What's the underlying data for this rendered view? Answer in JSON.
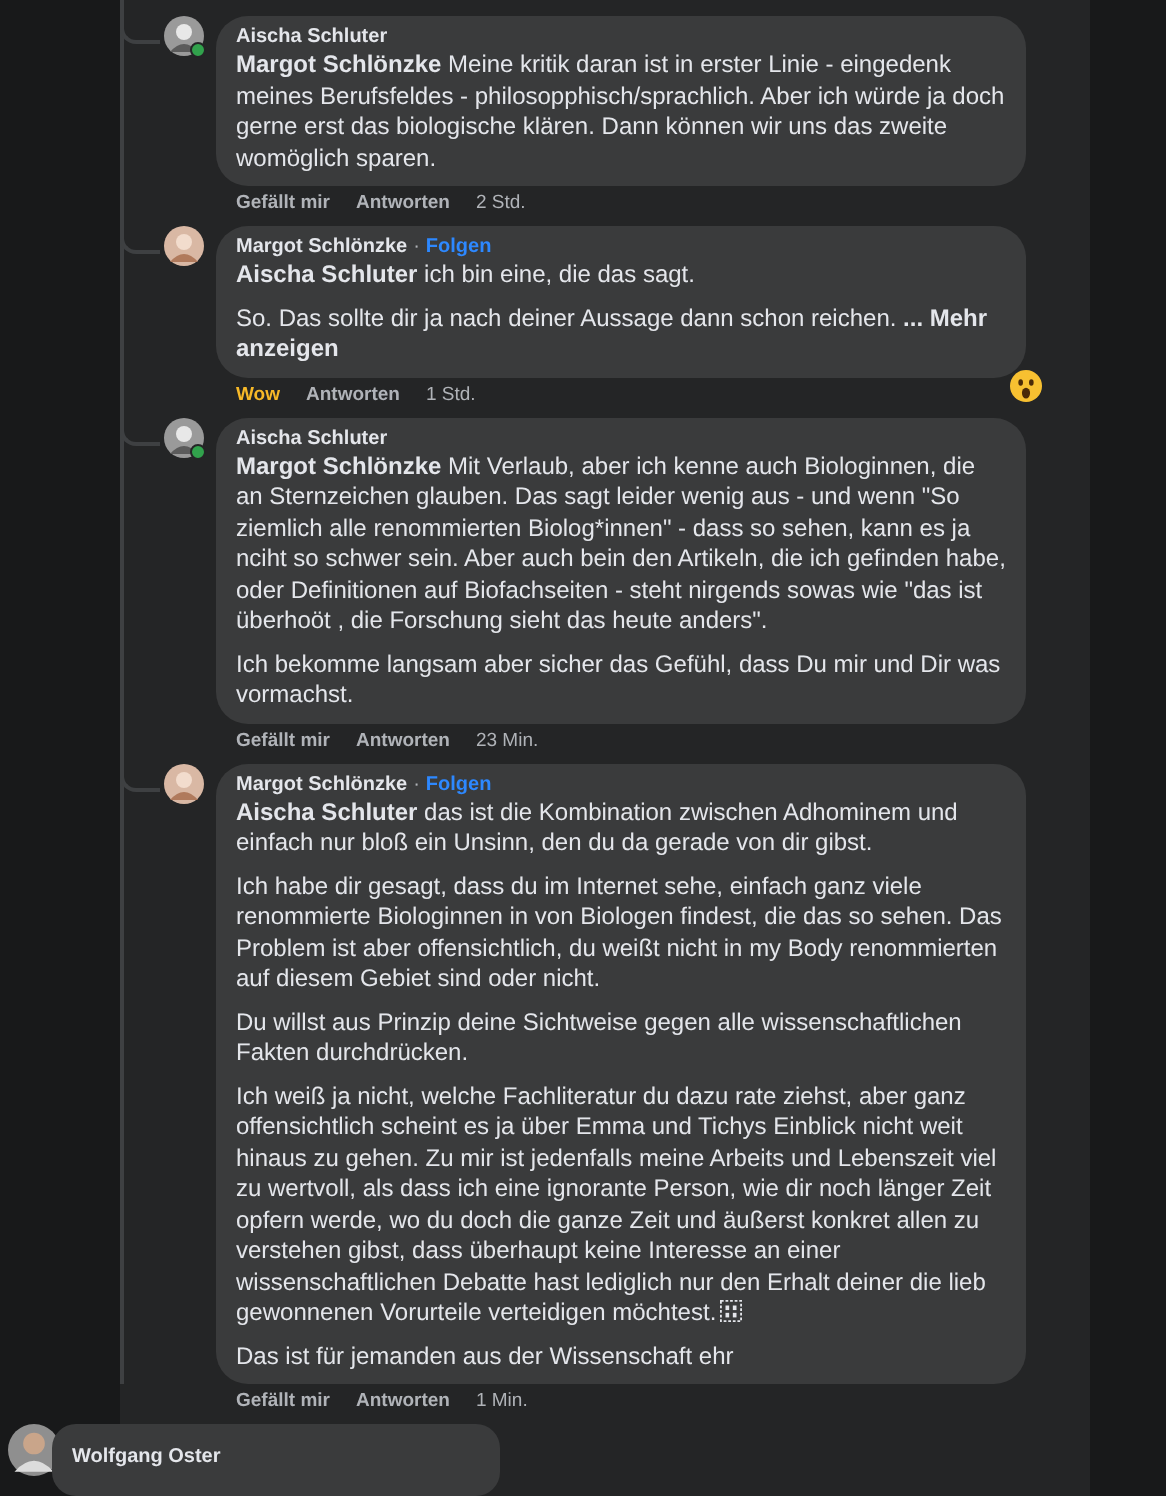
{
  "comments": [
    {
      "author": "Aischa Schluter",
      "online": true,
      "paragraphs": [
        "**Margot Schlönzke** Meine kritik daran ist in erster Linie - eingedenk meines Berufsfeldes - philosopphisch/sprachlich. Aber ich würde ja doch gerne erst das biologische klären. Dann können wir uns das zweite womöglich sparen."
      ],
      "actions": {
        "like": {
          "label": "Gefällt mir",
          "kind": "none"
        },
        "reply": "Antworten",
        "time": "2 Std."
      }
    },
    {
      "author": "Margot Schlönzke",
      "online": false,
      "separator": "·",
      "follow": "Folgen",
      "paragraphs": [
        "**Aischa Schluter** ich bin eine, die das sagt.",
        "So. Das sollte dir ja nach deiner Aussage dann schon reichen. **... Mehr anzeigen**"
      ],
      "reaction": {
        "kind": "wow"
      },
      "actions": {
        "like": {
          "label": "Wow",
          "kind": "wow"
        },
        "reply": "Antworten",
        "time": "1 Std."
      }
    },
    {
      "author": "Aischa Schluter",
      "online": true,
      "paragraphs": [
        "**Margot Schlönzke** Mit Verlaub, aber ich kenne auch Biologinnen, die an Sternzeichen glauben. Das sagt leider wenig aus - und wenn \"So ziemlich alle renommierten Biolog*innen\" - dass so sehen, kann es ja nciht so schwer sein. Aber auch bein den Artikeln, die ich gefinden habe, oder Definitionen auf Biofachseiten - steht nirgends sowas wie \"das ist überhoöt , die Forschung sieht das heute anders\".",
        "Ich bekomme langsam aber sicher das Gefühl, dass Du mir und Dir was vormachst."
      ],
      "actions": {
        "like": {
          "label": "Gefällt mir",
          "kind": "none"
        },
        "reply": "Antworten",
        "time": "23 Min."
      }
    },
    {
      "author": "Margot Schlönzke",
      "online": false,
      "separator": "·",
      "follow": "Folgen",
      "paragraphs": [
        "**Aischa Schluter** das ist die Kombination zwischen Adhominem und einfach nur bloß ein Unsinn, den du da gerade von dir gibst.",
        "Ich habe dir gesagt, dass du im Internet sehe, einfach ganz viele renommierte Biologinnen in von Biologen findest, die das so sehen. Das Problem ist aber offensichtlich, du weißt nicht in my Body renommierten auf diesem Gebiet sind oder nicht.",
        "Du willst aus Prinzip deine Sichtweise gegen alle wissenschaftlichen Fakten durchdrücken.",
        "Ich weiß ja nicht, welche Fachliteratur du dazu rate ziehst, aber ganz offensichtlich scheint es ja über Emma und Tichys Einblick nicht weit hinaus zu gehen. Zu mir ist jedenfalls meine Arbeits und Lebenszeit viel zu wertvoll, als dass ich eine ignorante Person, wie dir noch länger Zeit opfern werde, wo du doch die ganze Zeit und äußerst konkret allen zu verstehen gibst, dass überhaupt keine Interesse an einer wissenschaftlichen Debatte hast lediglich nur den Erhalt deiner die lieb gewonnenen Vorurteile verteidigen möchtest.",
        "Das ist für jemanden aus der Wissenschaft ehr"
      ],
      "glyph_box": true,
      "actions": {
        "like": {
          "label": "Gefällt mir",
          "kind": "none"
        },
        "reply": "Antworten",
        "time": "1 Min."
      }
    }
  ],
  "next_comment": {
    "author": "Wolfgang Oster"
  }
}
